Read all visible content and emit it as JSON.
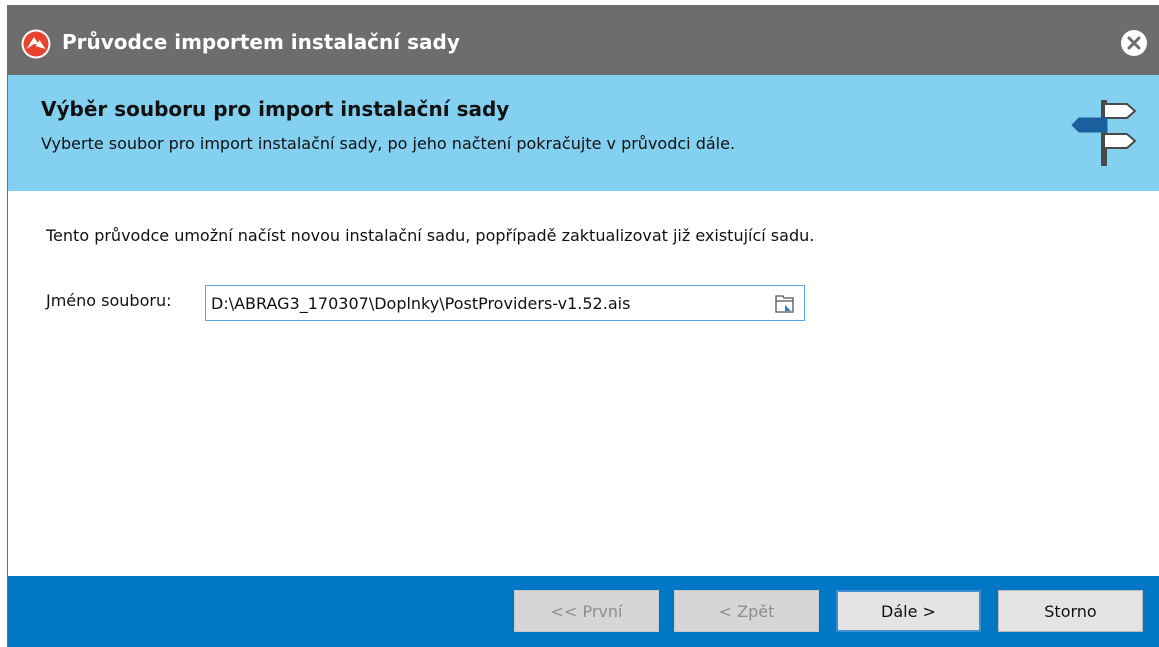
{
  "window": {
    "title": "Průvodce importem instalační sady"
  },
  "header": {
    "title": "Výběr souboru pro import instalační sady",
    "subtitle": "Vyberte soubor pro import instalační sady, po jeho načtení pokračujte v průvodci dále."
  },
  "content": {
    "description": "Tento průvodce umožní načíst novou instalační sadu, popřípadě zaktualizovat již existující sadu.",
    "file_label": "Jméno souboru:",
    "file_value": "D:\\ABRAG3_170307\\Doplnky\\PostProviders-v1.52.ais"
  },
  "buttons": {
    "first": "<< První",
    "back": "< Zpět",
    "next": "Dále >",
    "cancel": "Storno"
  },
  "colors": {
    "titlebar": "#6d6d6d",
    "header": "#84d0f0",
    "footer": "#0277c6",
    "accent": "#3f8fd0"
  },
  "icons": {
    "app": "app-logo-icon",
    "close": "close-icon",
    "header": "signpost-icon",
    "browse": "folder-browse-icon"
  }
}
